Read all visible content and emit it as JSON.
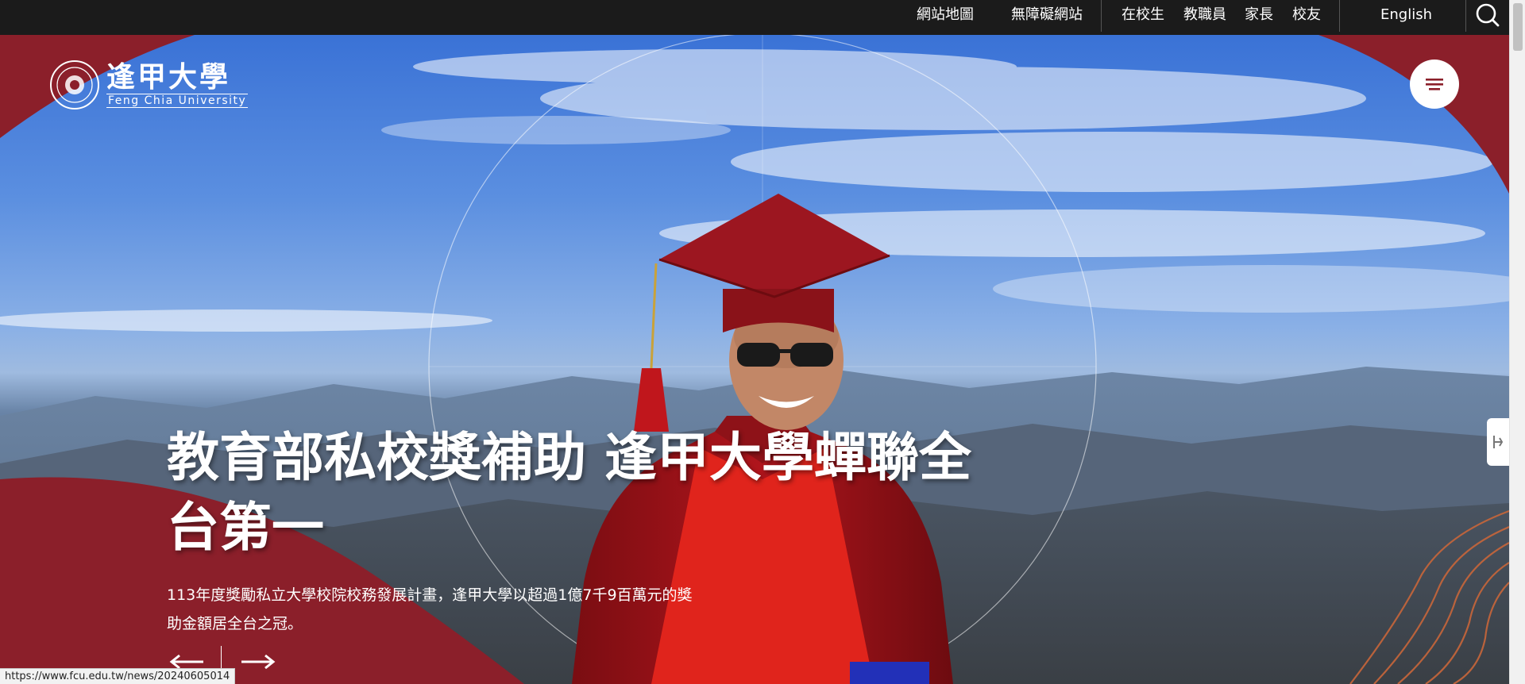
{
  "topbar": {
    "links": {
      "sitemap": "網站地圖",
      "accessibility": "無障礙網站",
      "students": "在校生",
      "faculty": "教職員",
      "parents": "家長",
      "alumni": "校友",
      "english": "English"
    },
    "search_icon": "search-icon"
  },
  "logo": {
    "name_cn": "逢甲大學",
    "name_en": "Feng Chia University"
  },
  "menu": {
    "icon": "hamburger-menu-icon"
  },
  "slide": {
    "headline_line1": "教育部私校獎補助 逢甲大學蟬聯全",
    "headline_line2": "台第一",
    "summary_line1": "113年度獎勵私立大學校院校務發展計畫，逢甲大學以超過1億7千9百萬元的獎",
    "summary_line2": "助金額居全台之冠。",
    "prev_icon": "arrow-left-icon",
    "next_icon": "arrow-right-icon"
  },
  "status_bar": {
    "url": "https://www.fcu.edu.tw/news/20240605014"
  },
  "colors": {
    "brand": "#8b1f2a",
    "topbar": "#1b1b1b",
    "text": "#ffffff"
  }
}
